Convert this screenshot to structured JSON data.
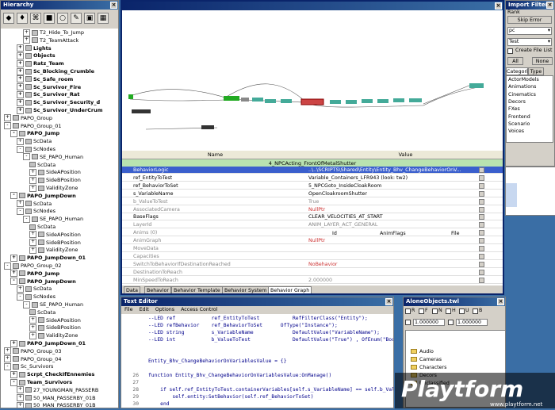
{
  "hierarchy": {
    "title": "Hierarchy",
    "nodes": [
      {
        "label": "T2_Hide_To_Jump",
        "indent": 6,
        "bold": false,
        "exp": "+"
      },
      {
        "label": "T2_TeamAttack",
        "indent": 6,
        "bold": false,
        "exp": "+"
      },
      {
        "label": "Lights",
        "indent": 5,
        "bold": true,
        "exp": "+"
      },
      {
        "label": "Objects",
        "indent": 5,
        "bold": true,
        "exp": "+"
      },
      {
        "label": "Ratz_Team",
        "indent": 5,
        "bold": true,
        "exp": "+"
      },
      {
        "label": "Sc_Blocking_Crumble",
        "indent": 5,
        "bold": true,
        "exp": "+"
      },
      {
        "label": "Sc_Safe_room",
        "indent": 5,
        "bold": true,
        "exp": "+"
      },
      {
        "label": "Sc_Survivor_Fire",
        "indent": 5,
        "bold": true,
        "exp": "+"
      },
      {
        "label": "Sc_Survivor_Rat",
        "indent": 5,
        "bold": true,
        "exp": "+"
      },
      {
        "label": "Sc_Survivor_Security_d",
        "indent": 5,
        "bold": true,
        "exp": "+"
      },
      {
        "label": "Sc_Survivor_UnderCrum",
        "indent": 5,
        "bold": true,
        "exp": "+"
      },
      {
        "label": "PAPO_Group",
        "indent": 3,
        "bold": false,
        "exp": "+"
      },
      {
        "label": "PAPO_Group_01",
        "indent": 3,
        "bold": false,
        "exp": "-"
      },
      {
        "label": "PAPO_Jump",
        "indent": 4,
        "bold": true,
        "exp": "-"
      },
      {
        "label": "ScData",
        "indent": 5,
        "bold": false,
        "exp": "+"
      },
      {
        "label": "ScNodes",
        "indent": 5,
        "bold": false,
        "exp": "-"
      },
      {
        "label": "SE_PAPO_Human",
        "indent": 6,
        "bold": false,
        "exp": "-"
      },
      {
        "label": "ScData",
        "indent": 7,
        "bold": false,
        "exp": ""
      },
      {
        "label": "SideAPosition",
        "indent": 7,
        "bold": false,
        "exp": "+"
      },
      {
        "label": "SideBPosition",
        "indent": 7,
        "bold": false,
        "exp": "+"
      },
      {
        "label": "ValidityZone",
        "indent": 7,
        "bold": false,
        "exp": "+"
      },
      {
        "label": "PAPO_JumpDown",
        "indent": 4,
        "bold": true,
        "exp": "-"
      },
      {
        "label": "ScData",
        "indent": 5,
        "bold": false,
        "exp": "+"
      },
      {
        "label": "ScNodes",
        "indent": 5,
        "bold": false,
        "exp": "-"
      },
      {
        "label": "SE_PAPO_Human",
        "indent": 6,
        "bold": false,
        "exp": "-"
      },
      {
        "label": "ScData",
        "indent": 7,
        "bold": false,
        "exp": ""
      },
      {
        "label": "SideAPosition",
        "indent": 7,
        "bold": false,
        "exp": "+"
      },
      {
        "label": "SideBPosition",
        "indent": 7,
        "bold": false,
        "exp": "+"
      },
      {
        "label": "ValidityZone",
        "indent": 7,
        "bold": false,
        "exp": "+"
      },
      {
        "label": "PAPO_JumpDown_01",
        "indent": 4,
        "bold": true,
        "exp": "+"
      },
      {
        "label": "PAPO_Group_02",
        "indent": 3,
        "bold": false,
        "exp": "-"
      },
      {
        "label": "PAPO_Jump",
        "indent": 4,
        "bold": true,
        "exp": "+"
      },
      {
        "label": "PAPO_JumpDown",
        "indent": 4,
        "bold": true,
        "exp": "-"
      },
      {
        "label": "ScData",
        "indent": 5,
        "bold": false,
        "exp": "+"
      },
      {
        "label": "ScNodes",
        "indent": 5,
        "bold": false,
        "exp": "-"
      },
      {
        "label": "SE_PAPO_Human",
        "indent": 6,
        "bold": false,
        "exp": "-"
      },
      {
        "label": "ScData",
        "indent": 7,
        "bold": false,
        "exp": ""
      },
      {
        "label": "SideAPosition",
        "indent": 7,
        "bold": false,
        "exp": "+"
      },
      {
        "label": "SideBPosition",
        "indent": 7,
        "bold": false,
        "exp": "+"
      },
      {
        "label": "ValidityZone",
        "indent": 7,
        "bold": false,
        "exp": "+"
      },
      {
        "label": "PAPO_JumpDown_01",
        "indent": 4,
        "bold": true,
        "exp": "+"
      },
      {
        "label": "PAPO_Group_03",
        "indent": 3,
        "bold": false,
        "exp": "+"
      },
      {
        "label": "PAPO_Group_04",
        "indent": 3,
        "bold": false,
        "exp": "+"
      },
      {
        "label": "Sc_Survivors",
        "indent": 3,
        "bold": false,
        "exp": "-"
      },
      {
        "label": "Scrpt_CheckIfEnnemies",
        "indent": 4,
        "bold": true,
        "exp": "+"
      },
      {
        "label": "Team_Survivors",
        "indent": 4,
        "bold": true,
        "exp": "-"
      },
      {
        "label": "27_YOUNGMAN_PASSERB",
        "indent": 5,
        "bold": false,
        "exp": "+"
      },
      {
        "label": "50_MAN_PASSERBY_01B",
        "indent": 5,
        "bold": false,
        "exp": "+"
      },
      {
        "label": "50_MAN_PASSERBY_01B",
        "indent": 5,
        "bold": false,
        "exp": "+"
      }
    ]
  },
  "graph": {
    "header_name": "Name",
    "header_value": "Value",
    "selected_node": "4_NPCActing_FrontOfMetalShutter",
    "props": [
      {
        "name": "BehaviorLogic",
        "value": "..\\..\\SCRIPTS\\Shared\\Entity\\Entity_Bhv_ChangeBehaviorOnV...",
        "style": "sel"
      },
      {
        "name": "ref_EntityToTest",
        "value": "Variable_Containers_LFR943 (look: tw2)",
        "style": ""
      },
      {
        "name": "ref_BehaviorToSet",
        "value": "5_NPCGoto_InsideCloakRoom",
        "style": ""
      },
      {
        "name": "s_VariableName",
        "value": "OpenCloakroomShutter",
        "style": ""
      },
      {
        "name": "b_ValueToTest",
        "value": "True",
        "style": "grey"
      },
      {
        "name": "AssociatedCamera",
        "value": "NullPtr",
        "style": "red"
      },
      {
        "name": "BaseFlags",
        "value": "CLEAR_VELOCITIES_AT_START",
        "style": ""
      },
      {
        "name": "LayerId",
        "value": "ANIM_LAYER_ACT_GENERAL",
        "style": "grey"
      },
      {
        "name": "Anims (0)",
        "value": "",
        "style": "grey"
      },
      {
        "name": "AnimGraph",
        "value": "NullPtr",
        "style": "red"
      },
      {
        "name": "MoveData",
        "value": "",
        "style": "grey"
      },
      {
        "name": "Capacities",
        "value": "",
        "style": "grey"
      },
      {
        "name": "SwitchToBehaviorIfDestinationReached",
        "value": "NoBehavior",
        "style": "red"
      },
      {
        "name": "DestinationToReach",
        "value": "",
        "style": "grey"
      },
      {
        "name": "MinSpeedToReach",
        "value": "2.000000",
        "style": "grey"
      }
    ],
    "anims_cols": [
      "Id",
      "AnimFlags",
      "File"
    ],
    "tabs": [
      "Data",
      "Behavior",
      "Behavior Template",
      "Behavior System",
      "Behavior Graph"
    ],
    "active_tab": 4
  },
  "filters": {
    "title": "Import Filters",
    "rank_label": "Rank",
    "skip_error": "Skip Error",
    "pc_value": "pc",
    "test_value": "Test",
    "create_file_list": "Create File List",
    "all_btn": "All",
    "none_btn": "None",
    "tab_categories": "Categories",
    "tab_type": "Type",
    "categories": [
      "ActorModels",
      "Animations",
      "Cinematics",
      "Decors",
      "FXes",
      "Frontend",
      "Scenario",
      "Voices"
    ]
  },
  "editor": {
    "title": "Text Editor",
    "menu": [
      "File",
      "Edit",
      "Options",
      "Access Control"
    ],
    "lines": [
      {
        "n": "",
        "t": "--LED ref            ref_EntityToTest           RefFilterClass(\"Entity\");"
      },
      {
        "n": "",
        "t": "--LED refBehavior    ref_BehaviorToSet      OfType(\"Instance\");"
      },
      {
        "n": "",
        "t": "--LED string         s_VariableName             DefaultValue(\"VariableName\");"
      },
      {
        "n": "",
        "t": "--LED int            b_ValueToTest              DefaultValue(\"True\") , OfEnum(\"Bool\") , Extra_LuaTyp"
      },
      {
        "n": "",
        "t": ""
      },
      {
        "n": "",
        "t": ""
      },
      {
        "n": "",
        "t": "Entity_Bhv_ChangeBehaviorOnVariablesValue = {}"
      },
      {
        "n": "",
        "t": ""
      },
      {
        "n": "26",
        "t": "function Entity_Bhv_ChangeBehaviorOnVariablesValue:OnManage()"
      },
      {
        "n": "27",
        "t": ""
      },
      {
        "n": "28",
        "t": "    if self.ref_EntityToTest.containerVariables[self.s_VariableName] == self.b_ValueToTest then"
      },
      {
        "n": "29",
        "t": "        self.entity:SetBehavior(self.ref_BehaviorToSet)"
      },
      {
        "n": "30",
        "t": "    end"
      }
    ]
  },
  "alone": {
    "title": "AloneObjects.twl",
    "checks": [
      "R",
      "F",
      "N",
      "H",
      "U",
      "B"
    ],
    "num1": "1.000000",
    "num2": "1.000000",
    "folders": [
      "Audio",
      "Cameras",
      "Characters",
      "Decors",
      "Unclassified"
    ]
  },
  "watermark": {
    "brand": "Playtform",
    "url": "www.playtform.net"
  }
}
